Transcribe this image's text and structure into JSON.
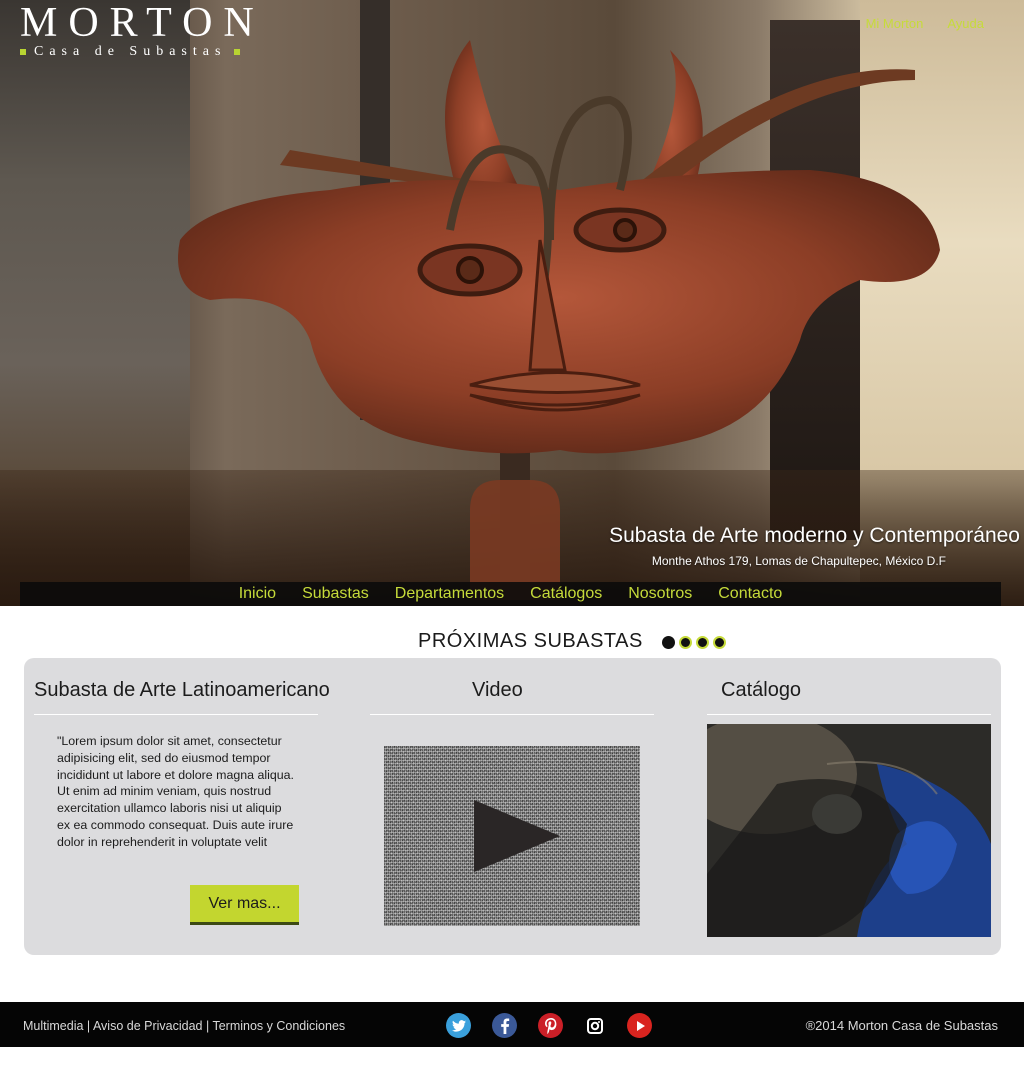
{
  "brand": {
    "name": "MORTON",
    "subtitle": "Casa de Subastas",
    "accent": "#c6db3a"
  },
  "top_nav": [
    {
      "label": "Mi Morton"
    },
    {
      "label": "Ayuda"
    }
  ],
  "hero": {
    "title": "Subasta de Arte moderno y Contemporáneo",
    "address": "Monthe Athos 179,  Lomas de Chapultepec, México D.F"
  },
  "main_nav": [
    {
      "label": "Inicio"
    },
    {
      "label": "Subastas"
    },
    {
      "label": "Departamentos"
    },
    {
      "label": "Catálogos"
    },
    {
      "label": "Nosotros"
    },
    {
      "label": "Contacto"
    }
  ],
  "upcoming": {
    "heading": "PRÓXIMAS SUBASTAS",
    "slides_total": 4,
    "slide_active": 1
  },
  "columns": {
    "auction_title": "Subasta de Arte Latinoamericano",
    "auction_text": "\"Lorem ipsum dolor sit amet, consectetur adipisicing elit, sed do eiusmod tempor incididunt ut labore et dolore magna aliqua. Ut enim ad minim veniam, quis nostrud exercitation ullamco laboris nisi ut aliquip ex ea commodo consequat. Duis aute irure dolor in reprehenderit in voluptate velit",
    "more_button": "Ver mas...",
    "video_title": "Video",
    "catalog_title": "Catálogo"
  },
  "footer": {
    "links": "Multimedia | Aviso de Privacidad | Terminos y Condiciones",
    "copyright": "®2014 Morton Casa de Subastas",
    "social_icons": [
      "twitter-icon",
      "facebook-icon",
      "pinterest-icon",
      "instagram-icon",
      "youtube-icon"
    ]
  }
}
